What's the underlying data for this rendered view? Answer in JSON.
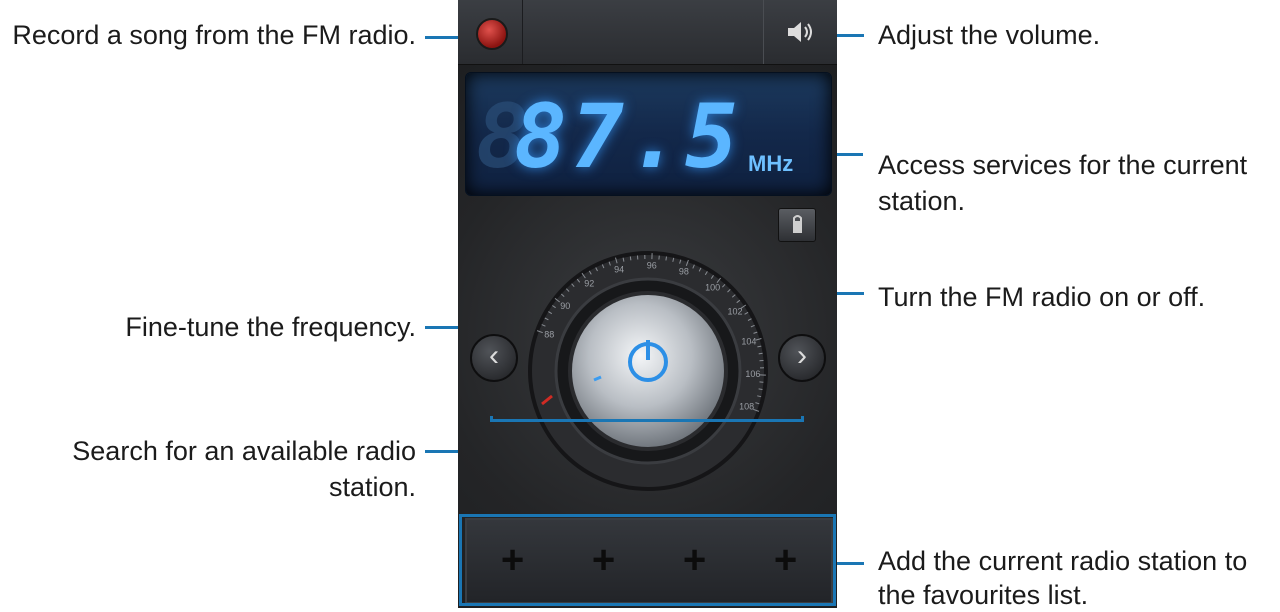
{
  "callouts": {
    "record": "Record a song from the FM radio.",
    "volume": "Adjust the volume.",
    "services_1": "Access services for the current",
    "services_2": "station.",
    "power": "Turn the FM radio on or off.",
    "finetune": "Fine-tune the frequency.",
    "search_1": "Search for an available radio",
    "search_2": "station.",
    "favourites_1": "Add the current radio station to",
    "favourites_2": "the favourites list."
  },
  "radio": {
    "frequency": "87.5",
    "ghost_digit": "8",
    "unit": "MHz",
    "dial_ticks": [
      "88",
      "90",
      "92",
      "94",
      "96",
      "98",
      "100",
      "102",
      "104",
      "106",
      "108"
    ]
  },
  "buttons": {
    "prev": "‹",
    "next": "›",
    "fav_add": "+"
  },
  "colors": {
    "accent": "#1a76b4",
    "display_text": "#5bb6ff",
    "record": "#c0302b"
  }
}
